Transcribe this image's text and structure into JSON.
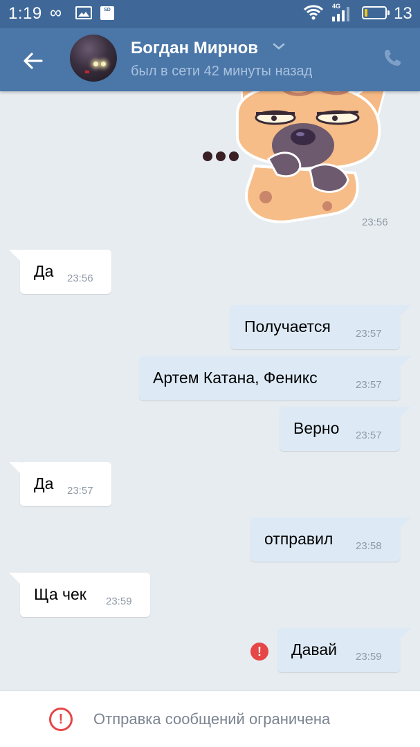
{
  "status_bar": {
    "time": "1:19",
    "sd_label": "SD",
    "network_label": "4G",
    "battery": "13",
    "battery_level": 0.13,
    "icons": [
      "infinity-icon",
      "gallery-icon",
      "sd-card-icon",
      "wifi-icon",
      "signal-icon",
      "battery-icon"
    ]
  },
  "header": {
    "back_icon": "arrow-left-icon",
    "name": "Богдан Мирнов",
    "status": "был в сети 42 минуты назад",
    "call_icon": "phone-icon",
    "accent": "#4a76a8"
  },
  "messages": [
    {
      "type": "sticker",
      "direction": "in",
      "sticker": "cat-thinking-sticker",
      "time": "23:56"
    },
    {
      "direction": "in",
      "text": "Да",
      "time": "23:56"
    },
    {
      "direction": "out",
      "text": "Получается",
      "time": "23:57"
    },
    {
      "direction": "out",
      "text": "Артем Катана, Феникс",
      "time": "23:57"
    },
    {
      "direction": "out",
      "text": "Верно",
      "time": "23:57"
    },
    {
      "direction": "in",
      "text": "Да",
      "time": "23:57"
    },
    {
      "direction": "out",
      "text": "отправил",
      "time": "23:58"
    },
    {
      "direction": "in",
      "text": "Ща чек",
      "time": "23:59"
    },
    {
      "direction": "out",
      "text": "Давай",
      "time": "23:59",
      "error": true,
      "error_icon": "exclamation-icon"
    }
  ],
  "error_icon_label": "!",
  "bottom_bar": {
    "icon": "warning-circle-icon",
    "icon_label": "!",
    "text": "Отправка сообщений ограничена",
    "color": "#e64646"
  },
  "colors": {
    "chat_background": "#e7ecf0",
    "incoming_bubble": "#ffffff",
    "outgoing_bubble": "#ddeaf6"
  }
}
